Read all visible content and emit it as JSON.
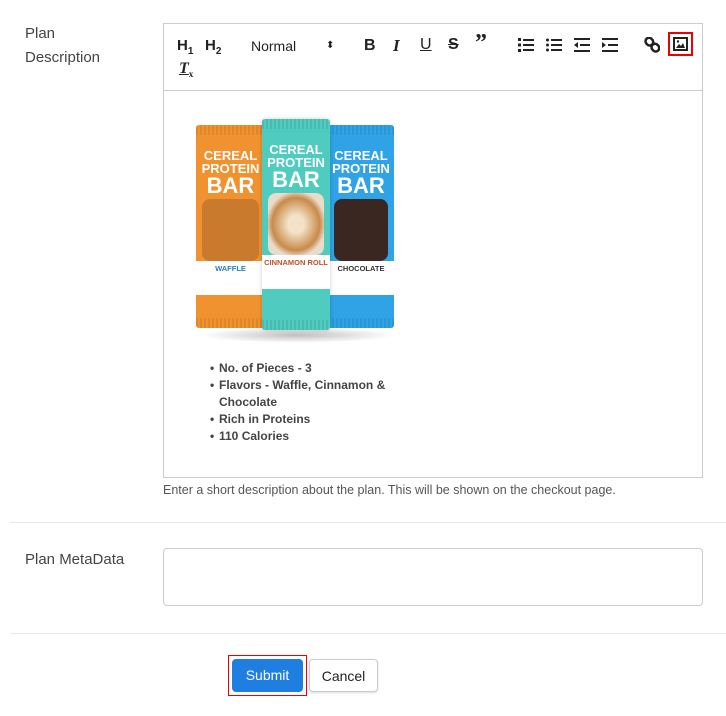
{
  "description": {
    "label_line1": "Plan",
    "label_line2": "Description",
    "toolbar": {
      "h1": "H1",
      "h2": "H2",
      "format_select": "Normal",
      "icons": [
        "header-1",
        "header-2",
        "format-select",
        "bold",
        "italic",
        "underline",
        "strike",
        "blockquote",
        "ordered-list",
        "bullet-list",
        "outdent",
        "indent",
        "link",
        "image",
        "clear-format"
      ],
      "highlight_color": "#e00000"
    },
    "image": {
      "bars": [
        {
          "line1": "CEREAL",
          "line2": "PROTEIN",
          "line3": "BAR",
          "flavor": "WAFFLE",
          "color": "#f0922f"
        },
        {
          "line1": "CEREAL",
          "line2": "PROTEIN",
          "line3": "BAR",
          "flavor": "CINNAMON ROLL",
          "color": "#4fcbc0"
        },
        {
          "line1": "CEREAL",
          "line2": "PROTEIN",
          "line3": "BAR",
          "flavor": "CHOCOLATE",
          "color": "#2fa3e6"
        }
      ]
    },
    "bullets": [
      "No. of Pieces - 3",
      "Flavors - Waffle, Cinnamon & Chocolate",
      "Rich in Proteins",
      "110 Calories"
    ],
    "help_text": "Enter a short description about the plan. This will be shown on the checkout page."
  },
  "metadata": {
    "label": "Plan MetaData",
    "value": ""
  },
  "actions": {
    "submit": "Submit",
    "cancel": "Cancel",
    "submit_color": "#1e7fe0"
  }
}
